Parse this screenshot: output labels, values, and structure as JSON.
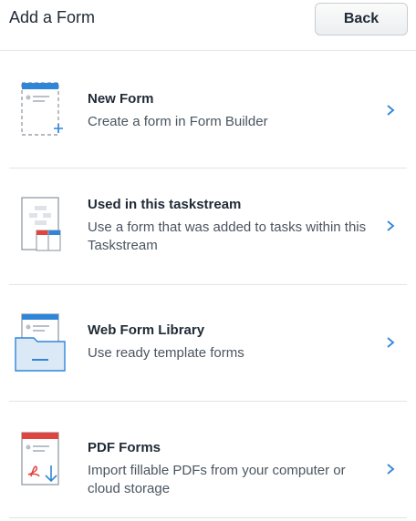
{
  "header": {
    "title": "Add a Form",
    "back_label": "Back"
  },
  "items": [
    {
      "name": "New Form",
      "desc": "Create a form in Form Builder",
      "icon": "new-form-icon"
    },
    {
      "name": "Used in this taskstream",
      "desc": "Use a form that was added to tasks within this Taskstream",
      "icon": "taskstream-form-icon"
    },
    {
      "name": "Web Form Library",
      "desc": "Use ready template forms",
      "icon": "form-library-icon"
    },
    {
      "name": "PDF Forms",
      "desc": "Import fillable PDFs from your computer or cloud storage",
      "icon": "pdf-form-icon"
    }
  ],
  "colors": {
    "accent": "#2f86d8",
    "pdf_red": "#e0443e",
    "separator": "#e4e4e4"
  }
}
